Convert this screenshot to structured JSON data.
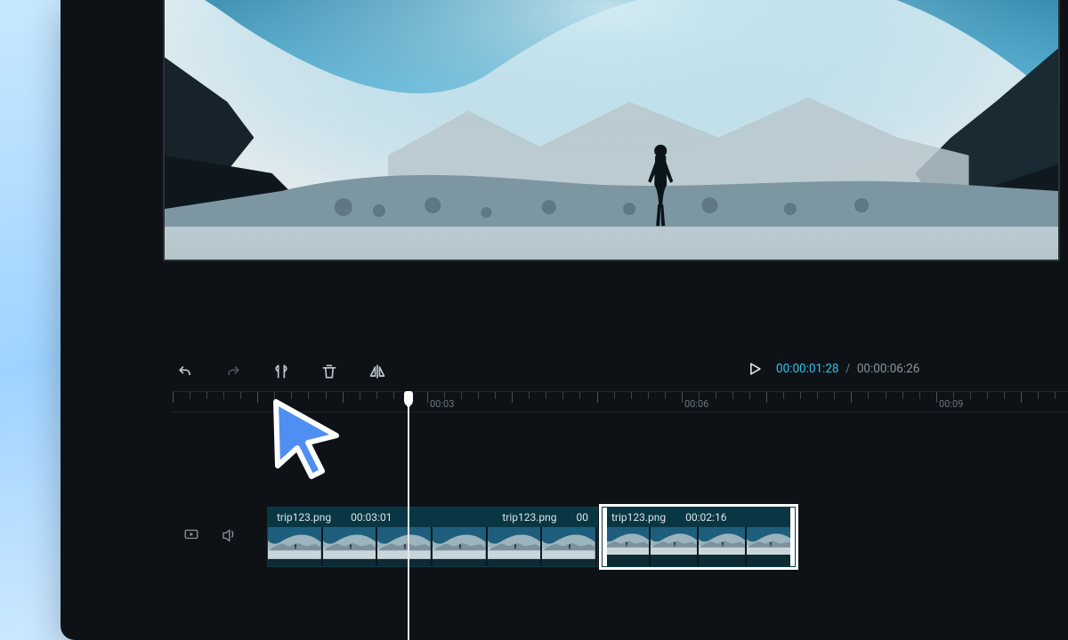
{
  "toolbar": {
    "undo": "Undo",
    "redo": "Redo",
    "split": "Split",
    "delete": "Delete",
    "mirror": "Mirror"
  },
  "playback": {
    "play_label": "Play",
    "current": "00:00:01:28",
    "separator": "/",
    "total": "00:00:06:26"
  },
  "ruler": {
    "labels": [
      "00:03",
      "00:06",
      "00:09"
    ]
  },
  "tracks": {
    "video_label": "Video track",
    "audio_label": "Audio track"
  },
  "clips": [
    {
      "filename": "trip123.png",
      "duration": "00:03:01",
      "filename2": "trip123.png",
      "partial_time": "00"
    },
    {
      "filename": "trip123.png",
      "duration": "00:02:16"
    }
  ],
  "colors": {
    "accent_cyan": "#2fc4e6",
    "clip_bg": "#083642",
    "panel_bg": "#0e1217"
  }
}
